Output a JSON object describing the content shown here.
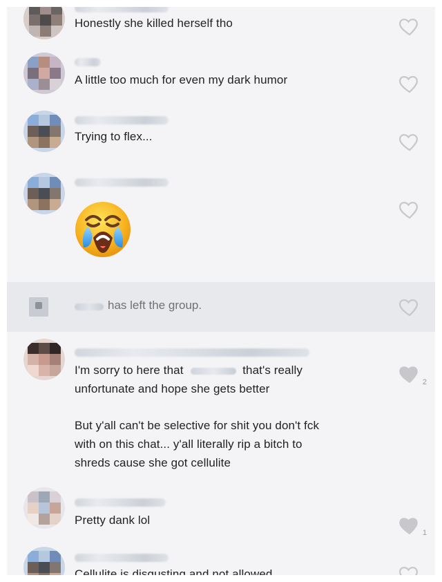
{
  "messages": [
    {
      "text": "Honestly she killed herself tho"
    },
    {
      "text": "A little too much for even my dark humor"
    },
    {
      "text": "Trying to flex..."
    },
    {
      "emoji": "crying-face"
    },
    {
      "system_text": "has left the group."
    },
    {
      "line1_before": "I'm sorry to here that",
      "line1_after": "that's really",
      "line2": "unfortunate and hope she gets better",
      "paragraph2": "But y'all can't be selective for shit you don't fck\nwith on this chat... y'all literally rip a bitch to\nshreds cause she got cellulite",
      "likes": "2"
    },
    {
      "text": "Pretty dank lol",
      "likes": "1"
    },
    {
      "text": "Cellulite is disgusting and not allowed"
    }
  ],
  "colors": {
    "background": "#f4f4f6",
    "system_background": "#e8e9ec",
    "text": "#222222",
    "secondary_text": "#6f7075",
    "heart_outline": "#c7c7cc",
    "heart_filled": "#c7c7cc"
  },
  "icons": {
    "heart_outline": "heart-outline-icon",
    "heart_filled": "heart-filled-icon",
    "group_icon": "group-icon"
  }
}
